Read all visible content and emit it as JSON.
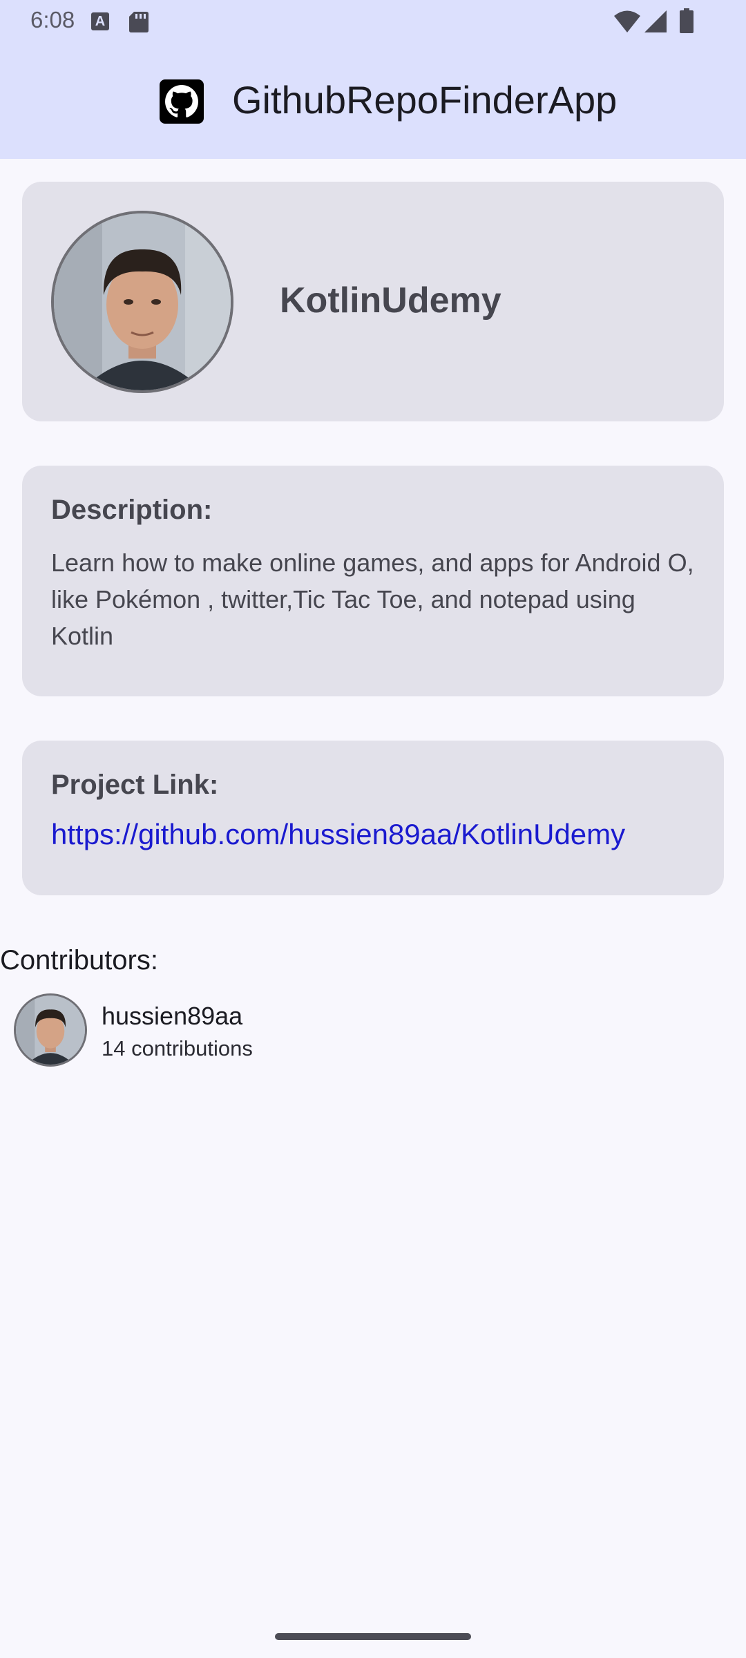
{
  "status_bar": {
    "time": "6:08",
    "icons": [
      "text-a-icon",
      "sd-card-icon",
      "wifi-icon",
      "signal-icon",
      "battery-icon"
    ]
  },
  "app_bar": {
    "title": "GithubRepoFinderApp",
    "logo_icon": "github-logo-icon",
    "background": "#dce0fd"
  },
  "repo": {
    "name": "KotlinUdemy",
    "description_label": "Description:",
    "description": "Learn how to make online games, and apps for Android O, like Pokémon , twitter,Tic Tac Toe, and notepad using Kotlin",
    "project_link_label": "Project Link:",
    "project_link": "https://github.com/hussien89aa/KotlinUdemy"
  },
  "contributors": {
    "label": "Contributors:",
    "items": [
      {
        "name": "hussien89aa",
        "contributions": "14 contributions"
      }
    ]
  },
  "colors": {
    "card": "#e2e1ea",
    "link": "#1a1acf",
    "background": "#f8f7fd"
  }
}
